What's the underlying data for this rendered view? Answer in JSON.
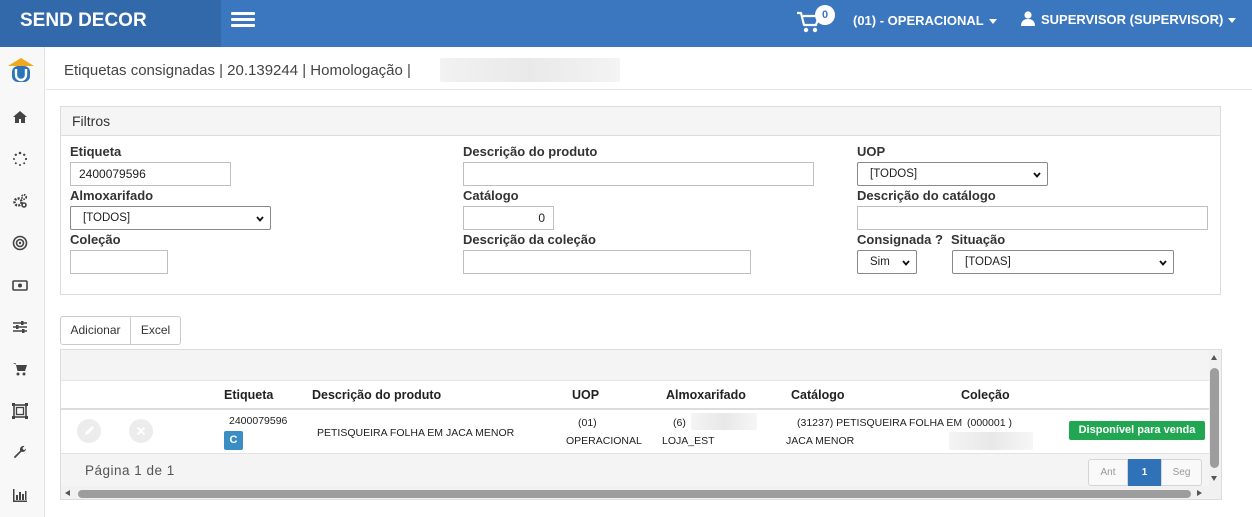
{
  "header": {
    "brand": "SEND DECOR",
    "cart_count": "0",
    "organization": "(01) - OPERACIONAL",
    "user": "SUPERVISOR (SUPERVISOR)"
  },
  "sidebar": {
    "items": [
      "home-icon",
      "spinner-icon",
      "cogs-icon",
      "target-icon",
      "money-icon",
      "sliders-icon",
      "cart-icon",
      "frame-icon",
      "wrench-icon",
      "bar-chart-icon"
    ]
  },
  "breadcrumb": "Etiquetas consignadas | 20.139244 | Homologação |",
  "filters": {
    "title": "Filtros",
    "etiqueta_label": "Etiqueta",
    "etiqueta_value": "2400079596",
    "descricao_produto_label": "Descrição do produto",
    "descricao_produto_value": "",
    "uop_label": "UOP",
    "uop_value": "[TODOS]",
    "almoxarifado_label": "Almoxarifado",
    "almoxarifado_value": "[TODOS]",
    "catalogo_label": "Catálogo",
    "catalogo_value": "0",
    "descricao_catalogo_label": "Descrição do catálogo",
    "descricao_catalogo_value": "",
    "colecao_label": "Coleção",
    "colecao_value": "",
    "descricao_colecao_label": "Descrição da coleção",
    "descricao_colecao_value": "",
    "consignada_label": "Consignada ?",
    "consignada_value": "Sim",
    "situacao_label": "Situação",
    "situacao_value": "[TODAS]"
  },
  "actions": {
    "add_label": "Adicionar",
    "excel_label": "Excel"
  },
  "table": {
    "headers": {
      "etiqueta": "Etiqueta",
      "descricao": "Descrição do produto",
      "uop": "UOP",
      "almoxarifado": "Almoxarifado",
      "catalogo": "Catálogo",
      "colecao": "Coleção"
    },
    "rows": [
      {
        "etiqueta": "2400079596",
        "badge": "C",
        "descricao": "PETISQUEIRA FOLHA EM JACA MENOR",
        "uop_code": "(01)",
        "uop_name": "OPERACIONAL",
        "almox_code": "(6)",
        "almox_name": "LOJA_EST",
        "catalogo_line1": "(31237) PETISQUEIRA FOLHA EM",
        "catalogo_line2": "JACA MENOR",
        "colecao": "(000001 )",
        "status": "Disponível para venda"
      }
    ],
    "page_info": "Página 1 de 1",
    "pager": {
      "prev": "Ant",
      "current": "1",
      "next": "Seg"
    }
  },
  "colors": {
    "topbar": "#3a77be",
    "brand_bg": "#3269ab",
    "status_green": "#21a651",
    "badge_blue": "#3a8ec4",
    "pager_active": "#2f72b8"
  }
}
